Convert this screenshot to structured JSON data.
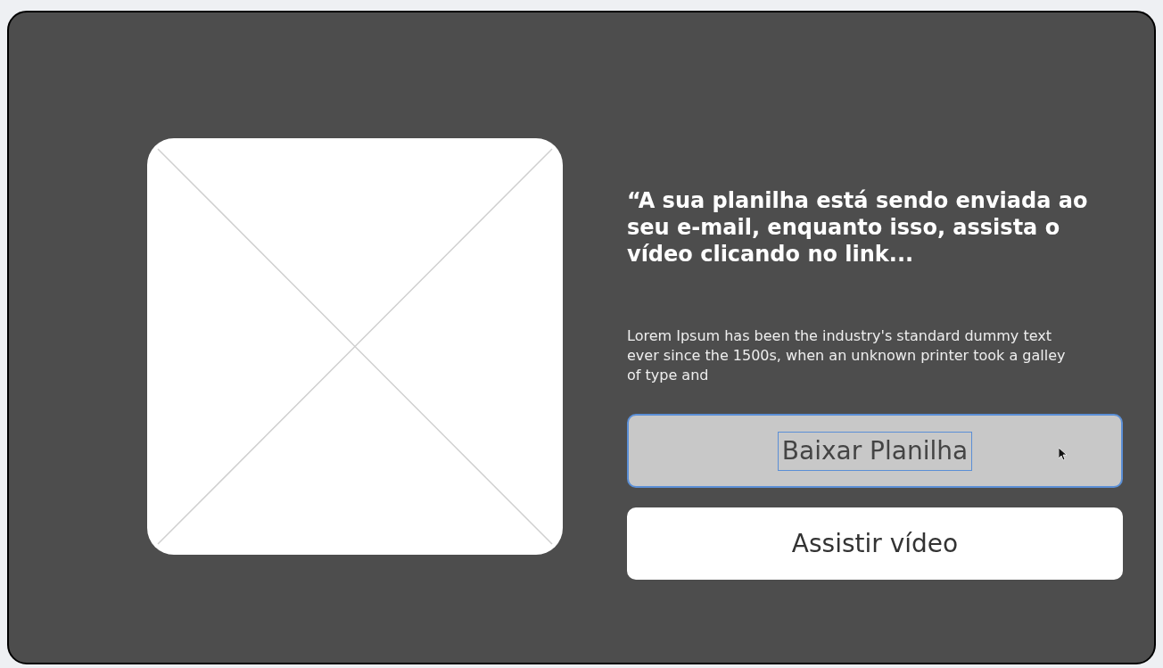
{
  "heading": "“A sua planilha está sendo enviada ao seu e-mail, enquanto isso, assista o vídeo clicando no link...",
  "body": "Lorem Ipsum has been the industry's standard dummy text ever since the 1500s, when an unknown printer took a galley of type and",
  "buttons": [
    {
      "label": "Baixar Planilha",
      "selected": true
    },
    {
      "label": "Assistir vídeo",
      "selected": false
    }
  ]
}
